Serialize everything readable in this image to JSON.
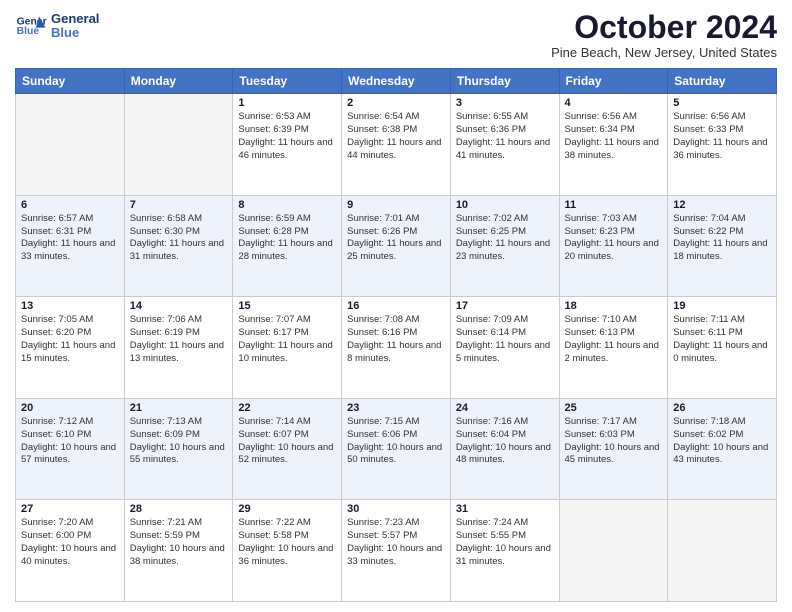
{
  "header": {
    "logo_line1": "General",
    "logo_line2": "Blue",
    "month_title": "October 2024",
    "location": "Pine Beach, New Jersey, United States"
  },
  "days_of_week": [
    "Sunday",
    "Monday",
    "Tuesday",
    "Wednesday",
    "Thursday",
    "Friday",
    "Saturday"
  ],
  "weeks": [
    [
      {
        "day": "",
        "empty": true
      },
      {
        "day": "",
        "empty": true
      },
      {
        "day": "1",
        "sunrise": "6:53 AM",
        "sunset": "6:39 PM",
        "daylight": "11 hours and 46 minutes."
      },
      {
        "day": "2",
        "sunrise": "6:54 AM",
        "sunset": "6:38 PM",
        "daylight": "11 hours and 44 minutes."
      },
      {
        "day": "3",
        "sunrise": "6:55 AM",
        "sunset": "6:36 PM",
        "daylight": "11 hours and 41 minutes."
      },
      {
        "day": "4",
        "sunrise": "6:56 AM",
        "sunset": "6:34 PM",
        "daylight": "11 hours and 38 minutes."
      },
      {
        "day": "5",
        "sunrise": "6:56 AM",
        "sunset": "6:33 PM",
        "daylight": "11 hours and 36 minutes."
      }
    ],
    [
      {
        "day": "6",
        "sunrise": "6:57 AM",
        "sunset": "6:31 PM",
        "daylight": "11 hours and 33 minutes."
      },
      {
        "day": "7",
        "sunrise": "6:58 AM",
        "sunset": "6:30 PM",
        "daylight": "11 hours and 31 minutes."
      },
      {
        "day": "8",
        "sunrise": "6:59 AM",
        "sunset": "6:28 PM",
        "daylight": "11 hours and 28 minutes."
      },
      {
        "day": "9",
        "sunrise": "7:01 AM",
        "sunset": "6:26 PM",
        "daylight": "11 hours and 25 minutes."
      },
      {
        "day": "10",
        "sunrise": "7:02 AM",
        "sunset": "6:25 PM",
        "daylight": "11 hours and 23 minutes."
      },
      {
        "day": "11",
        "sunrise": "7:03 AM",
        "sunset": "6:23 PM",
        "daylight": "11 hours and 20 minutes."
      },
      {
        "day": "12",
        "sunrise": "7:04 AM",
        "sunset": "6:22 PM",
        "daylight": "11 hours and 18 minutes."
      }
    ],
    [
      {
        "day": "13",
        "sunrise": "7:05 AM",
        "sunset": "6:20 PM",
        "daylight": "11 hours and 15 minutes."
      },
      {
        "day": "14",
        "sunrise": "7:06 AM",
        "sunset": "6:19 PM",
        "daylight": "11 hours and 13 minutes."
      },
      {
        "day": "15",
        "sunrise": "7:07 AM",
        "sunset": "6:17 PM",
        "daylight": "11 hours and 10 minutes."
      },
      {
        "day": "16",
        "sunrise": "7:08 AM",
        "sunset": "6:16 PM",
        "daylight": "11 hours and 8 minutes."
      },
      {
        "day": "17",
        "sunrise": "7:09 AM",
        "sunset": "6:14 PM",
        "daylight": "11 hours and 5 minutes."
      },
      {
        "day": "18",
        "sunrise": "7:10 AM",
        "sunset": "6:13 PM",
        "daylight": "11 hours and 2 minutes."
      },
      {
        "day": "19",
        "sunrise": "7:11 AM",
        "sunset": "6:11 PM",
        "daylight": "11 hours and 0 minutes."
      }
    ],
    [
      {
        "day": "20",
        "sunrise": "7:12 AM",
        "sunset": "6:10 PM",
        "daylight": "10 hours and 57 minutes."
      },
      {
        "day": "21",
        "sunrise": "7:13 AM",
        "sunset": "6:09 PM",
        "daylight": "10 hours and 55 minutes."
      },
      {
        "day": "22",
        "sunrise": "7:14 AM",
        "sunset": "6:07 PM",
        "daylight": "10 hours and 52 minutes."
      },
      {
        "day": "23",
        "sunrise": "7:15 AM",
        "sunset": "6:06 PM",
        "daylight": "10 hours and 50 minutes."
      },
      {
        "day": "24",
        "sunrise": "7:16 AM",
        "sunset": "6:04 PM",
        "daylight": "10 hours and 48 minutes."
      },
      {
        "day": "25",
        "sunrise": "7:17 AM",
        "sunset": "6:03 PM",
        "daylight": "10 hours and 45 minutes."
      },
      {
        "day": "26",
        "sunrise": "7:18 AM",
        "sunset": "6:02 PM",
        "daylight": "10 hours and 43 minutes."
      }
    ],
    [
      {
        "day": "27",
        "sunrise": "7:20 AM",
        "sunset": "6:00 PM",
        "daylight": "10 hours and 40 minutes."
      },
      {
        "day": "28",
        "sunrise": "7:21 AM",
        "sunset": "5:59 PM",
        "daylight": "10 hours and 38 minutes."
      },
      {
        "day": "29",
        "sunrise": "7:22 AM",
        "sunset": "5:58 PM",
        "daylight": "10 hours and 36 minutes."
      },
      {
        "day": "30",
        "sunrise": "7:23 AM",
        "sunset": "5:57 PM",
        "daylight": "10 hours and 33 minutes."
      },
      {
        "day": "31",
        "sunrise": "7:24 AM",
        "sunset": "5:55 PM",
        "daylight": "10 hours and 31 minutes."
      },
      {
        "day": "",
        "empty": true
      },
      {
        "day": "",
        "empty": true
      }
    ]
  ]
}
